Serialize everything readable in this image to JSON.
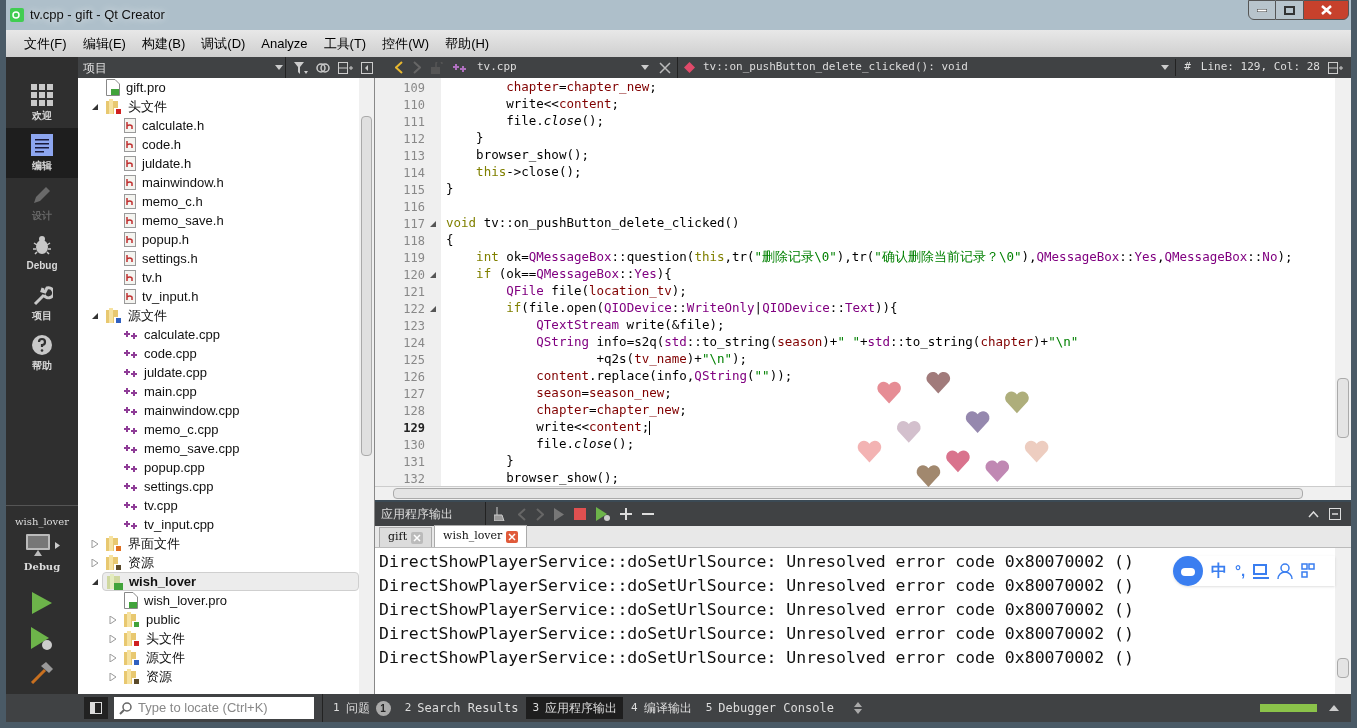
{
  "window": {
    "title": "tv.cpp - gift - Qt Creator"
  },
  "menu": [
    "文件(F)",
    "编辑(E)",
    "构建(B)",
    "调试(D)",
    "Analyze",
    "工具(T)",
    "控件(W)",
    "帮助(H)"
  ],
  "modes": [
    {
      "label": "欢迎",
      "selected": false,
      "disabled": false
    },
    {
      "label": "编辑",
      "selected": true,
      "disabled": false
    },
    {
      "label": "设计",
      "selected": false,
      "disabled": true
    },
    {
      "label": "Debug",
      "selected": false,
      "disabled": false
    },
    {
      "label": "项目",
      "selected": false,
      "disabled": false
    },
    {
      "label": "帮助",
      "selected": false,
      "disabled": false
    }
  ],
  "target": {
    "project": "wish_lover",
    "config": "Debug"
  },
  "project_pane": {
    "title": "项目",
    "tree": [
      {
        "children": [
          {
            "label": "gift.pro",
            "kind": "pro"
          },
          {
            "label": "头文件",
            "kind": "folder-h",
            "expanded": true,
            "children": [
              {
                "label": "calculate.h",
                "kind": "h"
              },
              {
                "label": "code.h",
                "kind": "h"
              },
              {
                "label": "juldate.h",
                "kind": "h"
              },
              {
                "label": "mainwindow.h",
                "kind": "h"
              },
              {
                "label": "memo_c.h",
                "kind": "h"
              },
              {
                "label": "memo_save.h",
                "kind": "h"
              },
              {
                "label": "popup.h",
                "kind": "h"
              },
              {
                "label": "settings.h",
                "kind": "h"
              },
              {
                "label": "tv.h",
                "kind": "h"
              },
              {
                "label": "tv_input.h",
                "kind": "h"
              }
            ]
          },
          {
            "label": "源文件",
            "kind": "folder-cpp",
            "expanded": true,
            "children": [
              {
                "label": "calculate.cpp",
                "kind": "cpp"
              },
              {
                "label": "code.cpp",
                "kind": "cpp"
              },
              {
                "label": "juldate.cpp",
                "kind": "cpp"
              },
              {
                "label": "main.cpp",
                "kind": "cpp"
              },
              {
                "label": "mainwindow.cpp",
                "kind": "cpp"
              },
              {
                "label": "memo_c.cpp",
                "kind": "cpp"
              },
              {
                "label": "memo_save.cpp",
                "kind": "cpp"
              },
              {
                "label": "popup.cpp",
                "kind": "cpp"
              },
              {
                "label": "settings.cpp",
                "kind": "cpp"
              },
              {
                "label": "tv.cpp",
                "kind": "cpp"
              },
              {
                "label": "tv_input.cpp",
                "kind": "cpp"
              }
            ]
          },
          {
            "label": "界面文件",
            "kind": "folder-ui",
            "expanded": false
          },
          {
            "label": "资源",
            "kind": "folder-res",
            "expanded": false
          }
        ]
      },
      {
        "label": "wish_lover",
        "kind": "project",
        "expanded": true,
        "selected": true,
        "children": [
          {
            "label": "wish_lover.pro",
            "kind": "pro"
          },
          {
            "label": "public",
            "kind": "folder-qt",
            "expanded": false
          },
          {
            "label": "头文件",
            "kind": "folder-h",
            "expanded": false
          },
          {
            "label": "源文件",
            "kind": "folder-cpp",
            "expanded": false
          },
          {
            "label": "资源",
            "kind": "folder-res",
            "expanded": false
          }
        ]
      }
    ]
  },
  "editor": {
    "file": "tv.cpp",
    "symbol": "tv::on_pushButton_delete_clicked(): void",
    "hash": "#",
    "position": "Line: 129, Col: 28",
    "lines": [
      {
        "number": "109",
        "fold": false,
        "current": false,
        "tokens": [
          {
            "text": "        chapter",
            "kind": "member"
          },
          {
            "text": "="
          },
          {
            "text": "chapter_new",
            "kind": "member"
          },
          {
            "text": ";"
          }
        ]
      },
      {
        "number": "110",
        "fold": false,
        "current": false,
        "tokens": [
          {
            "text": "        write<<"
          },
          {
            "text": "content",
            "kind": "member"
          },
          {
            "text": ";"
          }
        ]
      },
      {
        "number": "111",
        "fold": false,
        "current": false,
        "tokens": [
          {
            "text": "        file."
          },
          {
            "text": "close",
            "kind": "italic"
          },
          {
            "text": "();"
          }
        ]
      },
      {
        "number": "112",
        "fold": false,
        "current": false,
        "tokens": [
          {
            "text": "    }"
          }
        ]
      },
      {
        "number": "113",
        "fold": false,
        "current": false,
        "tokens": [
          {
            "text": "    browser_show();"
          }
        ]
      },
      {
        "number": "114",
        "fold": false,
        "current": false,
        "tokens": [
          {
            "text": "    this",
            "kind": "keyword"
          },
          {
            "text": "->close();"
          }
        ]
      },
      {
        "number": "115",
        "fold": false,
        "current": false,
        "tokens": [
          {
            "text": "}"
          }
        ]
      },
      {
        "number": "116",
        "fold": false,
        "current": false
      },
      {
        "number": "117",
        "fold": true,
        "current": false,
        "tokens": [
          {
            "text": "void",
            "kind": "keyword"
          },
          {
            "text": " tv::on_pushButton_delete_clicked()"
          }
        ]
      },
      {
        "number": "118",
        "fold": false,
        "current": false,
        "tokens": [
          {
            "text": "{"
          }
        ]
      },
      {
        "number": "119",
        "fold": false,
        "current": false,
        "tokens": [
          {
            "text": "    int",
            "kind": "keyword"
          },
          {
            "text": " ok="
          },
          {
            "text": "QMessageBox",
            "kind": "type"
          },
          {
            "text": "::question("
          },
          {
            "text": "this",
            "kind": "keyword"
          },
          {
            "text": ",tr("
          },
          {
            "text": "\"删除记录\\0\"",
            "kind": "string"
          },
          {
            "text": "),tr("
          },
          {
            "text": "\"确认删除当前记录？\\0\"",
            "kind": "string"
          },
          {
            "text": "),"
          },
          {
            "text": "QMessageBox",
            "kind": "type"
          },
          {
            "text": "::"
          },
          {
            "text": "Yes",
            "kind": "type"
          },
          {
            "text": ","
          },
          {
            "text": "QMessageBox",
            "kind": "type"
          },
          {
            "text": "::"
          },
          {
            "text": "No",
            "kind": "type"
          },
          {
            "text": ");"
          }
        ]
      },
      {
        "number": "120",
        "fold": true,
        "current": false,
        "tokens": [
          {
            "text": "    if",
            "kind": "keyword"
          },
          {
            "text": " (ok=="
          },
          {
            "text": "QMessageBox",
            "kind": "type"
          },
          {
            "text": "::"
          },
          {
            "text": "Yes",
            "kind": "type"
          },
          {
            "text": "){"
          }
        ]
      },
      {
        "number": "121",
        "fold": false,
        "current": false,
        "tokens": [
          {
            "text": "        QFile",
            "kind": "type"
          },
          {
            "text": " file("
          },
          {
            "text": "location_tv",
            "kind": "member"
          },
          {
            "text": ");"
          }
        ]
      },
      {
        "number": "122",
        "fold": true,
        "current": false,
        "tokens": [
          {
            "text": "        if",
            "kind": "keyword"
          },
          {
            "text": "(file.open("
          },
          {
            "text": "QIODevice",
            "kind": "type"
          },
          {
            "text": "::"
          },
          {
            "text": "WriteOnly",
            "kind": "type"
          },
          {
            "text": "|"
          },
          {
            "text": "QIODevice",
            "kind": "type"
          },
          {
            "text": "::"
          },
          {
            "text": "Text",
            "kind": "type"
          },
          {
            "text": ")){"
          }
        ]
      },
      {
        "number": "123",
        "fold": false,
        "current": false,
        "tokens": [
          {
            "text": "            QTextStream",
            "kind": "type"
          },
          {
            "text": " write(&file);"
          }
        ]
      },
      {
        "number": "124",
        "fold": false,
        "current": false,
        "tokens": [
          {
            "text": "            QString",
            "kind": "type"
          },
          {
            "text": " info=s2q("
          },
          {
            "text": "std",
            "kind": "type"
          },
          {
            "text": "::to_string("
          },
          {
            "text": "season",
            "kind": "member"
          },
          {
            "text": ")+"
          },
          {
            "text": "\" \"",
            "kind": "string"
          },
          {
            "text": "+"
          },
          {
            "text": "std",
            "kind": "type"
          },
          {
            "text": "::to_string("
          },
          {
            "text": "chapter",
            "kind": "member"
          },
          {
            "text": ")+"
          },
          {
            "text": "\"\\n\"",
            "kind": "string"
          }
        ]
      },
      {
        "number": "125",
        "fold": false,
        "current": false,
        "tokens": [
          {
            "text": "                    +q2s("
          },
          {
            "text": "tv_name",
            "kind": "member"
          },
          {
            "text": ")+"
          },
          {
            "text": "\"\\n\"",
            "kind": "string"
          },
          {
            "text": ");"
          }
        ]
      },
      {
        "number": "126",
        "fold": false,
        "current": false,
        "tokens": [
          {
            "text": "            content",
            "kind": "member"
          },
          {
            "text": ".replace(info,"
          },
          {
            "text": "QString",
            "kind": "type"
          },
          {
            "text": "("
          },
          {
            "text": "\"\"",
            "kind": "string"
          },
          {
            "text": "));"
          }
        ]
      },
      {
        "number": "127",
        "fold": false,
        "current": false,
        "tokens": [
          {
            "text": "            season",
            "kind": "member"
          },
          {
            "text": "="
          },
          {
            "text": "season_new",
            "kind": "member"
          },
          {
            "text": ";"
          }
        ]
      },
      {
        "number": "128",
        "fold": false,
        "current": false,
        "tokens": [
          {
            "text": "            chapter",
            "kind": "member"
          },
          {
            "text": "="
          },
          {
            "text": "chapter_new",
            "kind": "member"
          },
          {
            "text": ";"
          }
        ]
      },
      {
        "number": "129",
        "fold": false,
        "current": true,
        "tokens": [
          {
            "text": "            write<<"
          },
          {
            "text": "content",
            "kind": "member"
          },
          {
            "text": ";"
          }
        ]
      },
      {
        "number": "130",
        "fold": false,
        "current": false,
        "tokens": [
          {
            "text": "            file."
          },
          {
            "text": "close",
            "kind": "italic"
          },
          {
            "text": "();"
          }
        ]
      },
      {
        "number": "131",
        "fold": false,
        "current": false,
        "tokens": [
          {
            "text": "        }"
          }
        ]
      },
      {
        "number": "132",
        "fold": false,
        "current": false,
        "tokens": [
          {
            "text": "        browser_show();"
          }
        ]
      }
    ]
  },
  "output": {
    "title": "应用程序输出",
    "tabs": [
      {
        "label": "gift",
        "selected": false
      },
      {
        "label": "wish_lover",
        "selected": true
      }
    ],
    "lines": [
      "DirectShowPlayerService::doSetUrlSource: Unresolved error code 0x80070002 ()",
      "DirectShowPlayerService::doSetUrlSource: Unresolved error code 0x80070002 ()",
      "DirectShowPlayerService::doSetUrlSource: Unresolved error code 0x80070002 ()",
      "DirectShowPlayerService::doSetUrlSource: Unresolved error code 0x80070002 ()",
      "DirectShowPlayerService::doSetUrlSource: Unresolved error code 0x80070002 ()"
    ]
  },
  "ime": {
    "label": "中",
    "punct": "°,"
  },
  "status_bar": {
    "locate_placeholder": "Type to locate (Ctrl+K)",
    "panes": [
      {
        "number": "1",
        "label": "问题",
        "badge": "1",
        "selected": false
      },
      {
        "number": "2",
        "label": "Search Results",
        "selected": false
      },
      {
        "number": "3",
        "label": "应用程序输出",
        "selected": true
      },
      {
        "number": "4",
        "label": "编译输出",
        "selected": false
      },
      {
        "number": "5",
        "label": "Debugger Console",
        "selected": false
      }
    ],
    "progress": {
      "level": 1
    }
  }
}
